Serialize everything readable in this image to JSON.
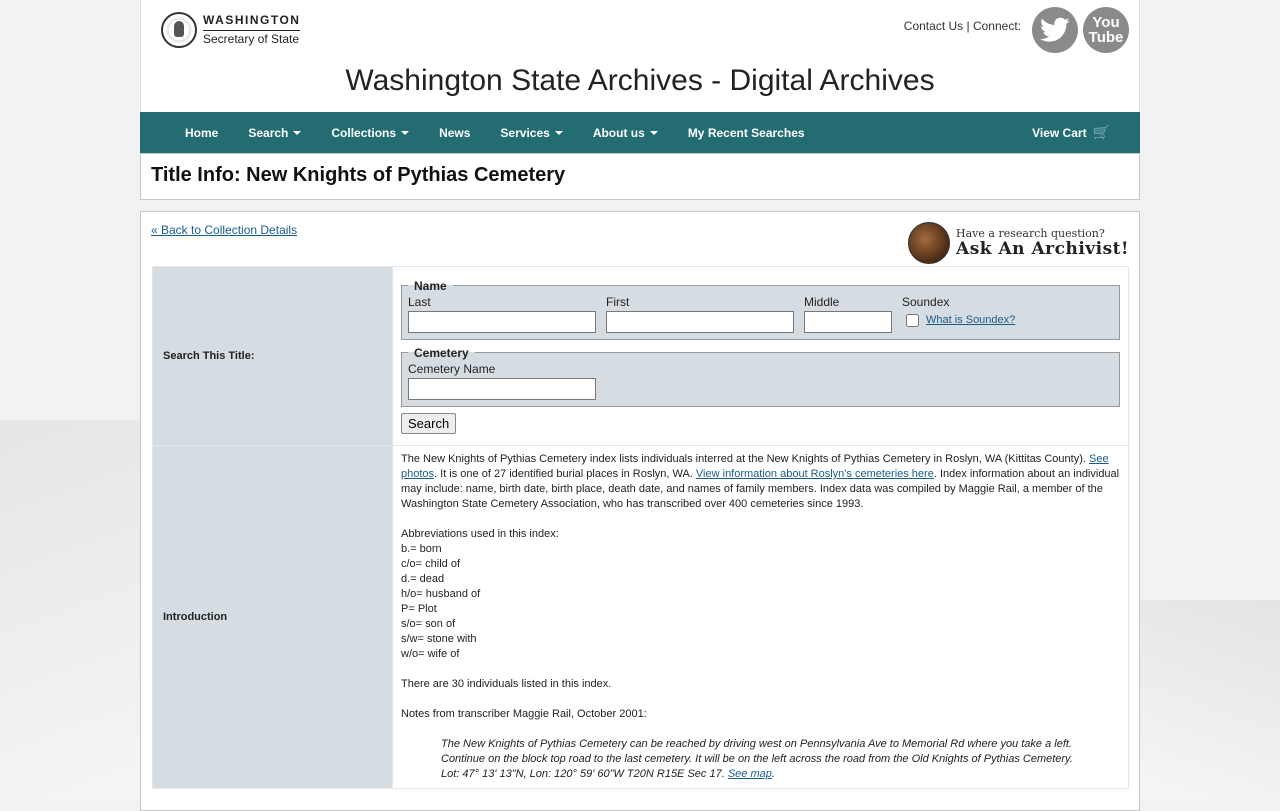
{
  "header": {
    "logo_line1": "WASHINGTON",
    "logo_line2": "Secretary of State",
    "contact": "Contact Us",
    "separator": "|",
    "connect": "Connect:",
    "youtube_you": "You",
    "youtube_tube": "Tube",
    "site_title": "Washington State Archives - Digital Archives"
  },
  "nav": {
    "items": [
      "Home",
      "Search",
      "Collections",
      "News",
      "Services",
      "About us",
      "My Recent Searches"
    ],
    "cart": "View Cart"
  },
  "page_title": "Title Info: New Knights of Pythias Cemetery",
  "back_link": "« Back to Collection Details",
  "ask": {
    "line1": "Have a research question?",
    "line2": "Ask An Archivist!"
  },
  "search": {
    "label": "Search This Title:",
    "name_legend": "Name",
    "last": "Last",
    "first": "First",
    "middle": "Middle",
    "soundex": "Soundex",
    "soundex_link": "What is Soundex?",
    "cemetery_legend": "Cemetery",
    "cemetery_name": "Cemetery Name",
    "button": "Search"
  },
  "intro": {
    "label": "Introduction",
    "p1_a": "The New Knights of Pythias Cemetery index lists individuals interred at the New Knights of Pythias Cemetery in Roslyn, WA (Kittitas County). ",
    "p1_link1": "See photos",
    "p1_b": ". It is one of 27 identified burial places in Roslyn, WA. ",
    "p1_link2": "View information about Roslyn's cemeteries here",
    "p1_c": ". Index information about an individual may include: name, birth date, birth place, death date, and names of family members. Index data was compiled by Maggie Rail, a member of the Washington State Cemetery Association, who has transcribed over 400 cemeteries since 1993.",
    "abbr_title": "Abbreviations used in this index:",
    "abbreviations": [
      "b.= born",
      "c/o= child of",
      "d.= dead",
      "h/o= husband of",
      "P= Plot",
      "s/o= son of",
      "s/w= stone with",
      "w/o= wife of"
    ],
    "count": "There are 30 individuals listed in this index.",
    "notes": "Notes from transcriber Maggie Rail, October 2001:",
    "quote1": "The New Knights of Pythias Cemetery can be reached by driving west on Pennsylvania Ave to Memorial Rd where you take a left.",
    "quote2": "Continue on the block top road to the last cemetery. It will be on the left across the road from the Old Knights of Pythias Cemetery.",
    "quote3": "Lot: 47° 13' 13\"N, Lon: 120° 59' 60\"W T20N R15E Sec 17. ",
    "map_link": "See map",
    "map_end": "."
  }
}
